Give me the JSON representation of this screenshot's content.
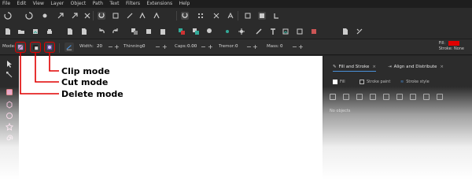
{
  "menu": [
    "File",
    "Edit",
    "View",
    "Layer",
    "Object",
    "Path",
    "Text",
    "Filters",
    "Extensions",
    "Help"
  ],
  "toolbar": {
    "mode_label": "Mode:",
    "width_label": "Width:",
    "width_value": "20",
    "thinning_label": "Thinning:",
    "thinning_value": "0",
    "caps_label": "Caps:",
    "caps_value": "0.00",
    "tremor_label": "Tremor:",
    "tremor_value": "0",
    "mass_label": "Mass:",
    "mass_value": "0",
    "minus": "−",
    "plus": "+"
  },
  "fill_stroke_indicator": {
    "fill_label": "Fill:",
    "fill_color": "#e00000",
    "stroke_label": "Stroke:",
    "stroke_value": "None"
  },
  "dock": {
    "tabs": [
      {
        "label": "Fill and Stroke",
        "close": "×"
      },
      {
        "label": "Align and Distribute",
        "close": "×"
      }
    ],
    "subtabs": [
      "Fill",
      "Stroke paint",
      "Stroke style"
    ],
    "no_paint_label": "No objects"
  },
  "annotations": {
    "clip": "Clip mode",
    "cut": "Cut mode",
    "delete": "Delete mode",
    "color": "#e00000"
  }
}
